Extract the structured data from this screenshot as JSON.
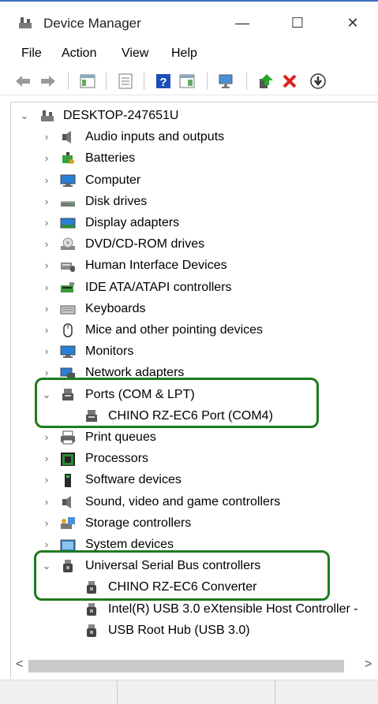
{
  "window": {
    "title": "Device Manager",
    "minimize": "—",
    "maximize": "☐",
    "close": "✕"
  },
  "menu": [
    "File",
    "Action",
    "View",
    "Help"
  ],
  "tree": {
    "root": "DESKTOP-247651U",
    "items": [
      {
        "label": "Audio inputs and outputs",
        "icon": "speaker-icon",
        "state": "collapsed"
      },
      {
        "label": "Batteries",
        "icon": "battery-icon",
        "state": "collapsed"
      },
      {
        "label": "Computer",
        "icon": "monitor-icon",
        "state": "collapsed"
      },
      {
        "label": "Disk drives",
        "icon": "disk-icon",
        "state": "collapsed"
      },
      {
        "label": "Display adapters",
        "icon": "display-adapter-icon",
        "state": "collapsed"
      },
      {
        "label": "DVD/CD-ROM drives",
        "icon": "dvd-icon",
        "state": "collapsed"
      },
      {
        "label": "Human Interface Devices",
        "icon": "hid-icon",
        "state": "collapsed"
      },
      {
        "label": "IDE ATA/ATAPI controllers",
        "icon": "ide-icon",
        "state": "collapsed"
      },
      {
        "label": "Keyboards",
        "icon": "keyboard-icon",
        "state": "collapsed"
      },
      {
        "label": "Mice and other pointing devices",
        "icon": "mouse-icon",
        "state": "collapsed"
      },
      {
        "label": "Monitors",
        "icon": "monitor-icon",
        "state": "collapsed"
      },
      {
        "label": "Network adapters",
        "icon": "network-icon",
        "state": "collapsed"
      },
      {
        "label": "Ports (COM & LPT)",
        "icon": "port-icon",
        "state": "expanded",
        "children": [
          {
            "label": "CHINO RZ-EC6 Port (COM4)",
            "icon": "port-icon"
          }
        ]
      },
      {
        "label": "Print queues",
        "icon": "printer-icon",
        "state": "collapsed"
      },
      {
        "label": "Processors",
        "icon": "processor-icon",
        "state": "collapsed"
      },
      {
        "label": "Software devices",
        "icon": "software-device-icon",
        "state": "collapsed"
      },
      {
        "label": "Sound, video and game controllers",
        "icon": "speaker-icon",
        "state": "collapsed"
      },
      {
        "label": "Storage controllers",
        "icon": "storage-icon",
        "state": "collapsed"
      },
      {
        "label": "System devices",
        "icon": "system-icon",
        "state": "collapsed"
      },
      {
        "label": "Universal Serial Bus controllers",
        "icon": "usb-icon",
        "state": "expanded",
        "children": [
          {
            "label": "CHINO RZ-EC6 Converter",
            "icon": "usb-icon"
          },
          {
            "label": "Intel(R) USB 3.0 eXtensible Host Controller -",
            "icon": "usb-icon"
          },
          {
            "label": "USB Root Hub (USB 3.0)",
            "icon": "usb-icon"
          }
        ]
      }
    ]
  },
  "colors": {
    "highlight": "#1e7a1e",
    "accent": "#3b6fb6"
  }
}
